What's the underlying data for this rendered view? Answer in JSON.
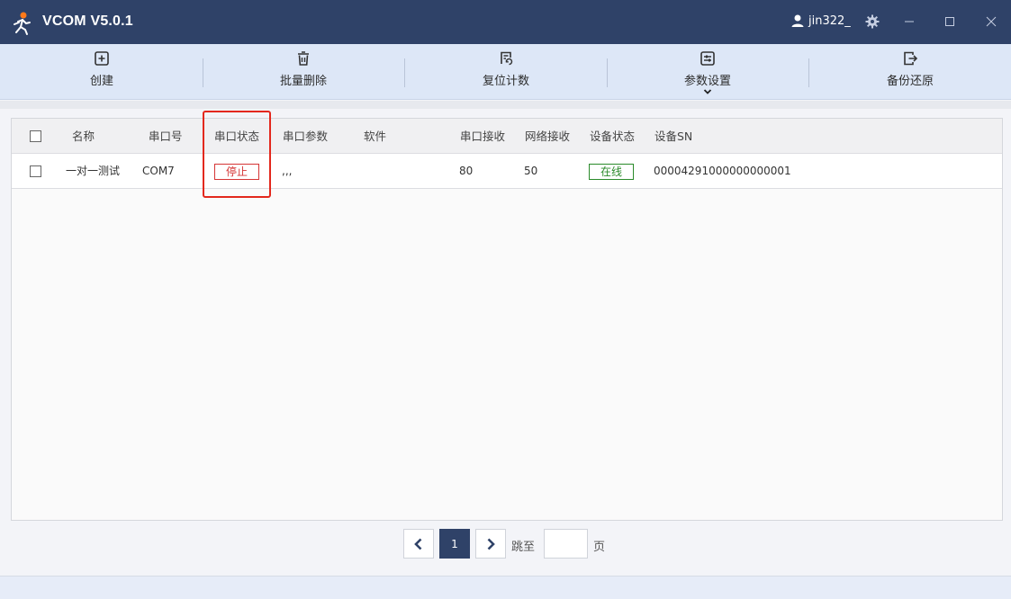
{
  "window": {
    "title": "VCOM V5.0.1",
    "username": "jin322_",
    "icons": [
      "runner-logo-icon",
      "user-icon",
      "gear-icon",
      "minimize-icon",
      "maximize-icon",
      "close-icon"
    ]
  },
  "toolbar": {
    "create_label": "创建",
    "batch_delete_label": "批量删除",
    "reset_count_label": "复位计数",
    "param_settings_label": "参数设置",
    "backup_restore_label": "备份还原"
  },
  "table": {
    "columns": {
      "name": "名称",
      "port": "串口号",
      "port_status": "串口状态",
      "port_params": "串口参数",
      "software": "软件",
      "serial_rx": "串口接收",
      "net_rx": "网络接收",
      "device_status": "设备状态",
      "device_sn": "设备SN"
    },
    "rows": [
      {
        "name": "一对一测试",
        "port": "COM7",
        "port_status": "停止",
        "port_params": ",,,",
        "software": "",
        "serial_rx": "80",
        "net_rx": "50",
        "device_status": "在线",
        "device_sn": "00004291000000000001"
      }
    ]
  },
  "pagination": {
    "current_page": "1",
    "goto_label": "跳至",
    "page_suffix": "页",
    "goto_value": ""
  },
  "colors": {
    "titlebar": "#2f4268",
    "toolbar": "#dde7f7",
    "stop": "#d53535",
    "online": "#2a8a2a",
    "highlight": "#e3281d"
  }
}
